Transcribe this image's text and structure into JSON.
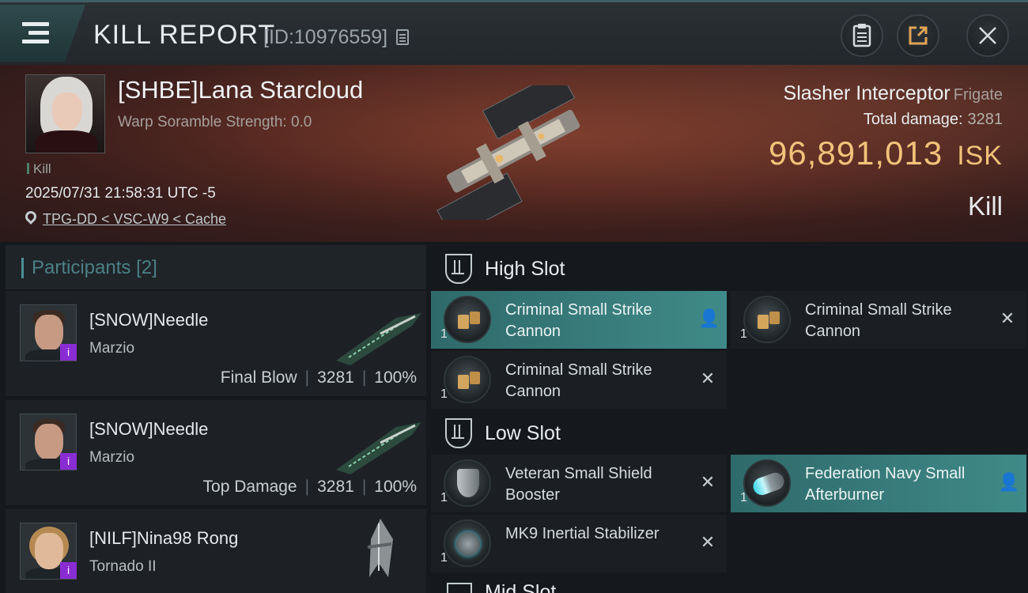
{
  "header": {
    "title": "KILL REPORT",
    "report_id": "[ID:10976559]",
    "icons": [
      "menu-icon",
      "copy-icon",
      "clipboard-icon",
      "share-icon",
      "close-icon"
    ]
  },
  "victim": {
    "name": "[SHBE]Lana Starcloud",
    "warp_scramble": "Warp Soramble Strength: 0.0",
    "tag": "Kill",
    "datetime": "2025/07/31 21:58:31 UTC -5",
    "location": "TPG-DD < VSC-W9 < Cache",
    "ship_name": "Slasher Interceptor",
    "ship_class": "Frigate",
    "total_damage_label": "Total damage:",
    "total_damage": "3281",
    "isk_value": "96,891,013",
    "isk_unit": "ISK",
    "result": "Kill"
  },
  "participants": {
    "label": "Participants",
    "count": "[2]",
    "items": [
      {
        "name": "[SNOW]Needle",
        "ship": "Marzio",
        "role": "Final Blow",
        "damage": "3281",
        "percent": "100%",
        "badge": "i"
      },
      {
        "name": "[SNOW]Needle",
        "ship": "Marzio",
        "role": "Top Damage",
        "damage": "3281",
        "percent": "100%",
        "badge": "i"
      },
      {
        "name": "[NILF]Nina98 Rong",
        "ship": "Tornado II",
        "badge": "i"
      }
    ]
  },
  "fitting": {
    "high_slot": {
      "title": "High Slot",
      "modules": [
        {
          "name": "Criminal Small Strike Cannon",
          "qty": "1",
          "status": "dropped"
        },
        {
          "name": "Criminal Small Strike Cannon",
          "qty": "1",
          "status": "destroyed"
        },
        {
          "name": "Criminal Small Strike Cannon",
          "qty": "1",
          "status": "destroyed"
        }
      ]
    },
    "low_slot": {
      "title": "Low Slot",
      "modules": [
        {
          "name": "Veteran Small Shield Booster",
          "qty": "1",
          "status": "destroyed"
        },
        {
          "name": "Federation Navy Small Afterburner",
          "qty": "1",
          "status": "dropped"
        },
        {
          "name": "MK9 Inertial Stabilizer",
          "qty": "1",
          "status": "destroyed"
        }
      ]
    },
    "next_slot_peek": "Mid Slot",
    "status_symbols": {
      "dropped": "👤",
      "destroyed": "✕"
    }
  }
}
